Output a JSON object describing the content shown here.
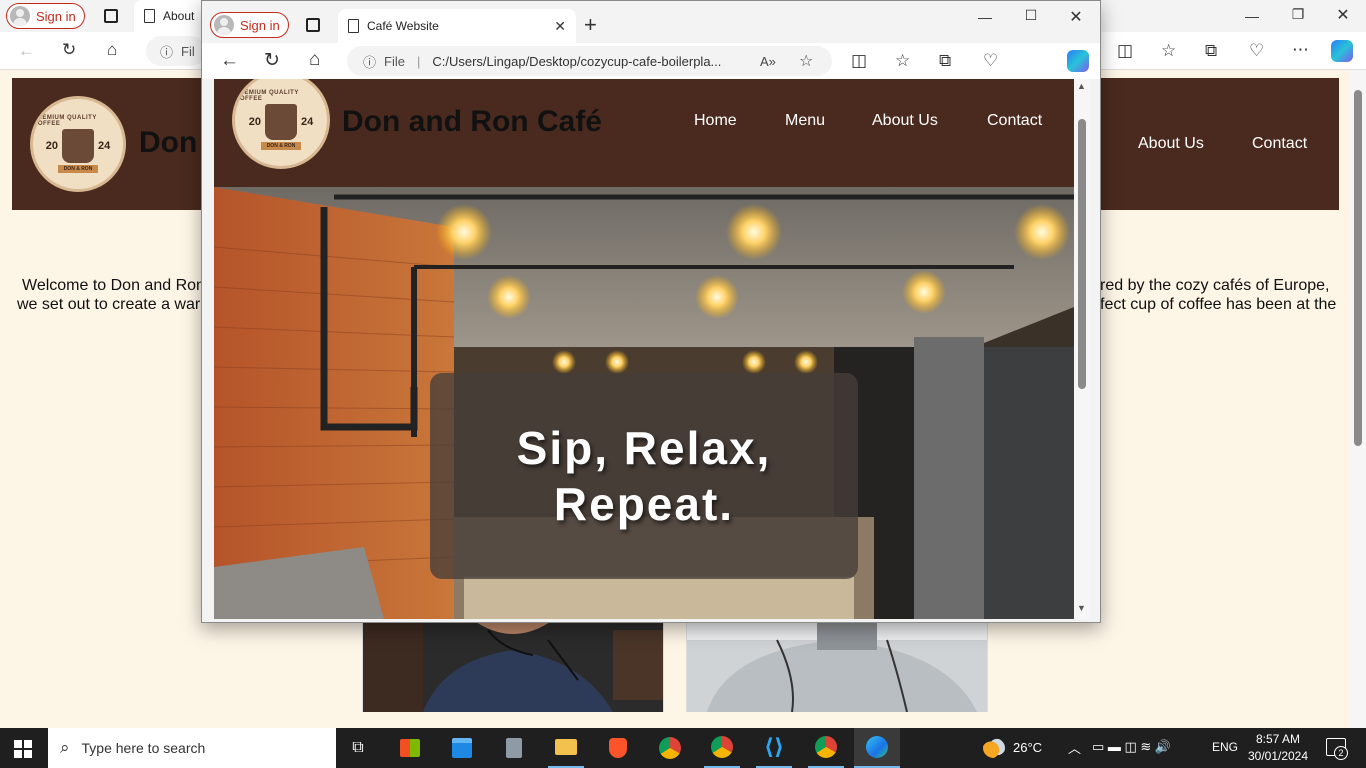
{
  "browser_common": {
    "signin_label": "Sign in",
    "file_label": "File"
  },
  "back_window": {
    "tab_title": "About",
    "address_fragment": "Fil",
    "nav_items": [
      "About Us",
      "Contact"
    ],
    "brand_fragment": "Don",
    "welcome_left_line1": "Welcome to Don and Ron",
    "welcome_left_line2": "we set out to create a war",
    "welcome_right_line1": "red by the cozy cafés of Europe,",
    "welcome_right_line2": "fect cup of coffee has been at the"
  },
  "front_window": {
    "tab_title": "Café Website",
    "address": "C:/Users/Lingap/Desktop/cozycup-cafe-boilerpla...",
    "brand": "Don and Ron Café",
    "nav_items": [
      "Home",
      "Menu",
      "About Us",
      "Contact"
    ],
    "hero_line1": "Sip, Relax,",
    "hero_line2": "Repeat."
  },
  "logo": {
    "ring_text": "PREMIUM QUALITY COFFEE",
    "year_left": "20",
    "year_right": "24",
    "ribbon": "DON & RON"
  },
  "taskbar": {
    "search_placeholder": "Type here to search",
    "weather_temp": "26°C",
    "language": "ENG",
    "time": "8:57 AM",
    "date": "30/01/2024",
    "notification_count": "2"
  },
  "icons": [
    "back-icon",
    "refresh-icon",
    "home-icon",
    "info-icon",
    "read-aloud-icon",
    "favorite-icon",
    "split-screen-icon",
    "favorites-icon",
    "collections-icon",
    "browser-essentials-icon",
    "more-icon",
    "copilot-icon",
    "windows-icon",
    "search-icon",
    "task-view-icon",
    "store-icon",
    "calendar-icon",
    "calculator-icon",
    "file-explorer-icon",
    "brave-icon",
    "chrome-icon",
    "vscode-icon",
    "edge-icon"
  ],
  "colors": {
    "header_brown": "#4a2a1e",
    "page_cream": "#fdf5e6",
    "signin_red": "#c42b1c",
    "taskbar": "#1f1f1f"
  }
}
